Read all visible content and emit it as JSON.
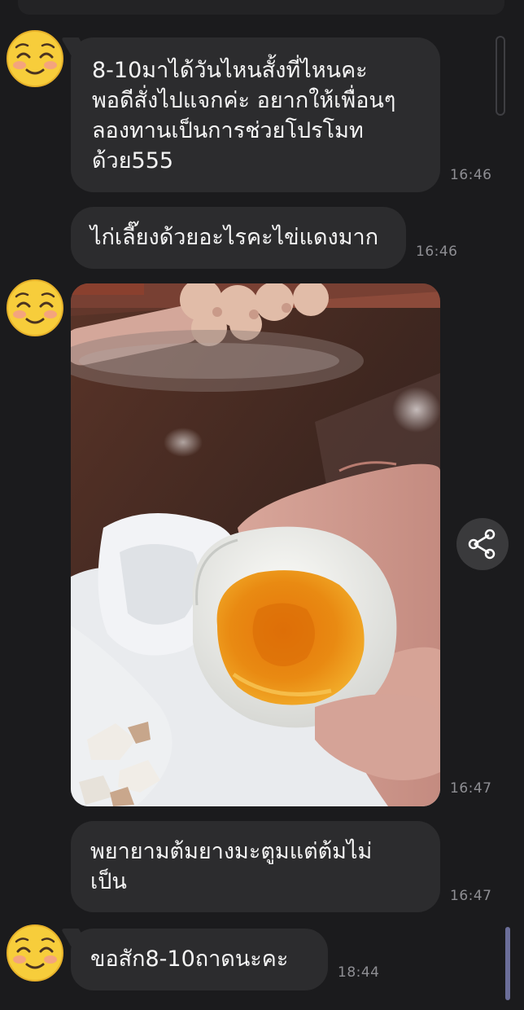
{
  "messages": [
    {
      "text": "8-10มาได้วันไหนสั้งที่ไหนคะ\nพอดีสั่งไปแจกค่ะ อยากให้เพื่อนๆ\nลองทานเป็นการช่วยโปรโมท\nด้วย555",
      "time": "16:46"
    },
    {
      "text": "ไก่เลี๊ยงด้วยอะไรคะไข่แดงมาก",
      "time": "16:46"
    },
    {
      "image": "salted-egg-photo",
      "time": "16:47"
    },
    {
      "text": "พยายามต้มยางมะตูมแต่ต้มไม่\nเป็น",
      "time": "16:47"
    },
    {
      "text": "ขอสัก8-10ถาดนะคะ",
      "time": "18:44"
    }
  ],
  "icons": {
    "avatar": "smiling-face-emoji",
    "share": "share-icon"
  },
  "colors": {
    "background": "#1b1b1d",
    "bubble": "#2c2c2e",
    "text": "#f4f4f4",
    "time": "#8e8e93",
    "scroll_thumb": "#6b6e99"
  }
}
